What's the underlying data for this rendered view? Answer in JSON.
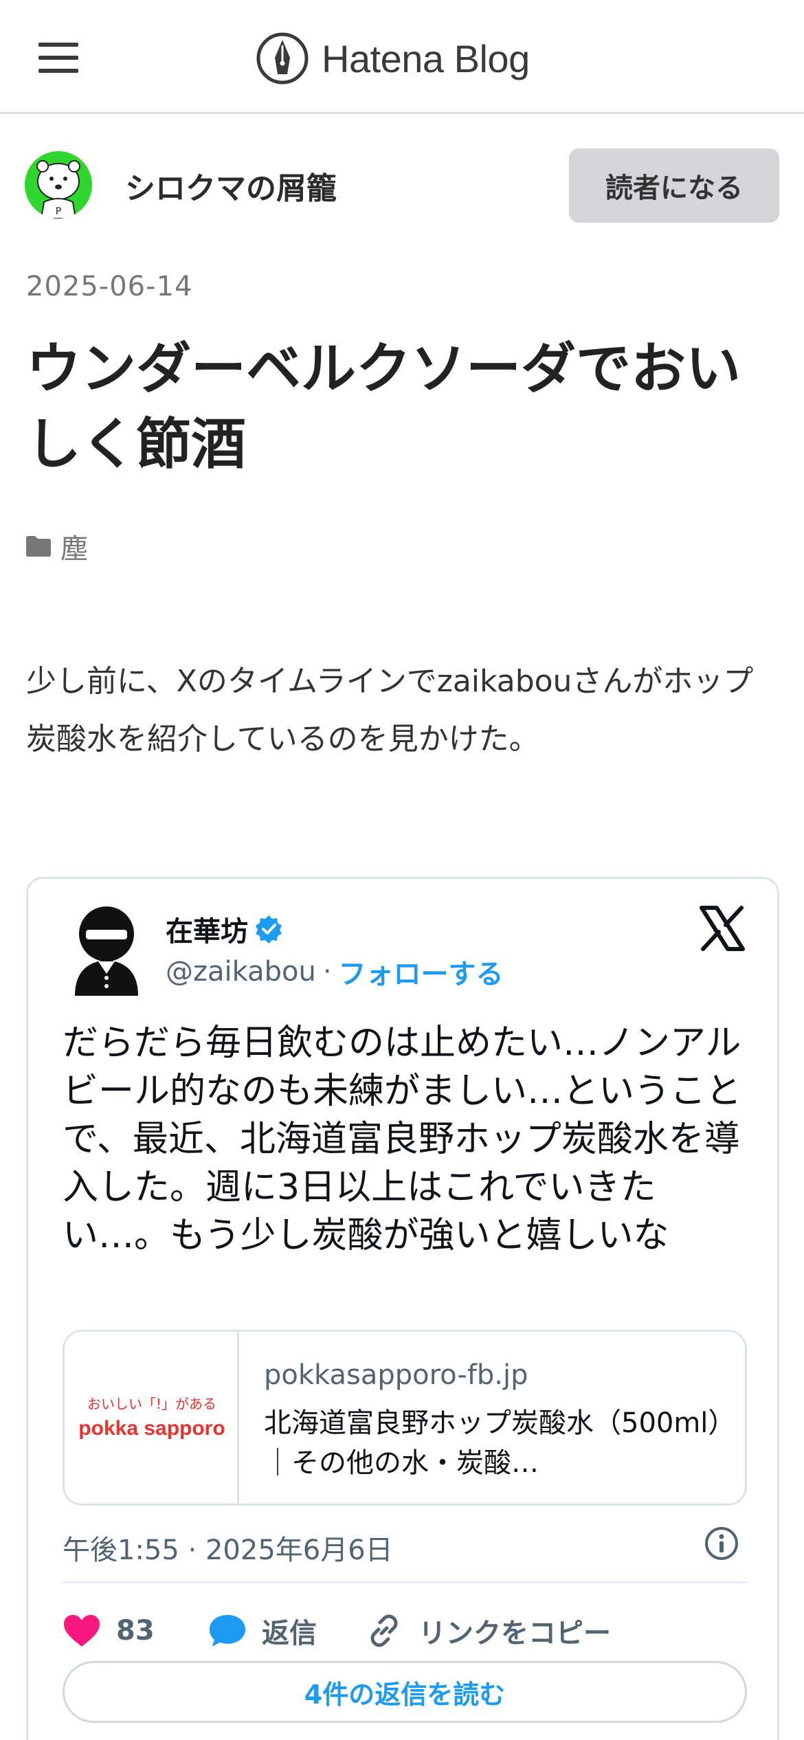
{
  "header": {
    "logo_text": "Hatena Blog",
    "menu_icon": "hamburger-menu-icon",
    "logo_icon": "hatena-pen-icon"
  },
  "blog": {
    "name": "シロクマの屑籠",
    "subscribe_label": "読者になる",
    "avatar_icon": "polar-bear-avatar"
  },
  "article": {
    "date": "2025-06-14",
    "title": "ウンダーベルクソーダでおいしく節酒",
    "category": "塵",
    "category_icon": "folder-icon",
    "body": "少し前に、Xのタイムラインでzaikabouさんがホップ炭酸水を紹介しているのを見かけた。"
  },
  "tweet": {
    "author_name": "在華坊",
    "verified_icon": "verified-badge-icon",
    "handle": "@zaikabou",
    "separator": "·",
    "follow_label": "フォローする",
    "text": "だらだら毎日飲むのは止めたい…ノンアルビール的なのも未練がましい…ということで、最近、北海道富良野ホップ炭酸水を導入した。週に3日以上はこれでいきたい…。もう少し炭酸が強いと嬉しいな",
    "link_card": {
      "domain": "pokkasapporo-fb.jp",
      "title": "北海道富良野ホップ炭酸水（500ml）｜その他の水・炭酸…",
      "thumb_tagline": "おいしい「!」がある",
      "thumb_brand": "pokka sapporo"
    },
    "timestamp": "午後1:55 · 2025年6月6日",
    "likes": "83",
    "reply_label": "返信",
    "copy_link_label": "リンクをコピー",
    "read_replies_label": "4件の返信を読む",
    "colors": {
      "accent": "#1d9bf0",
      "like": "#f91880",
      "muted": "#536471"
    }
  }
}
